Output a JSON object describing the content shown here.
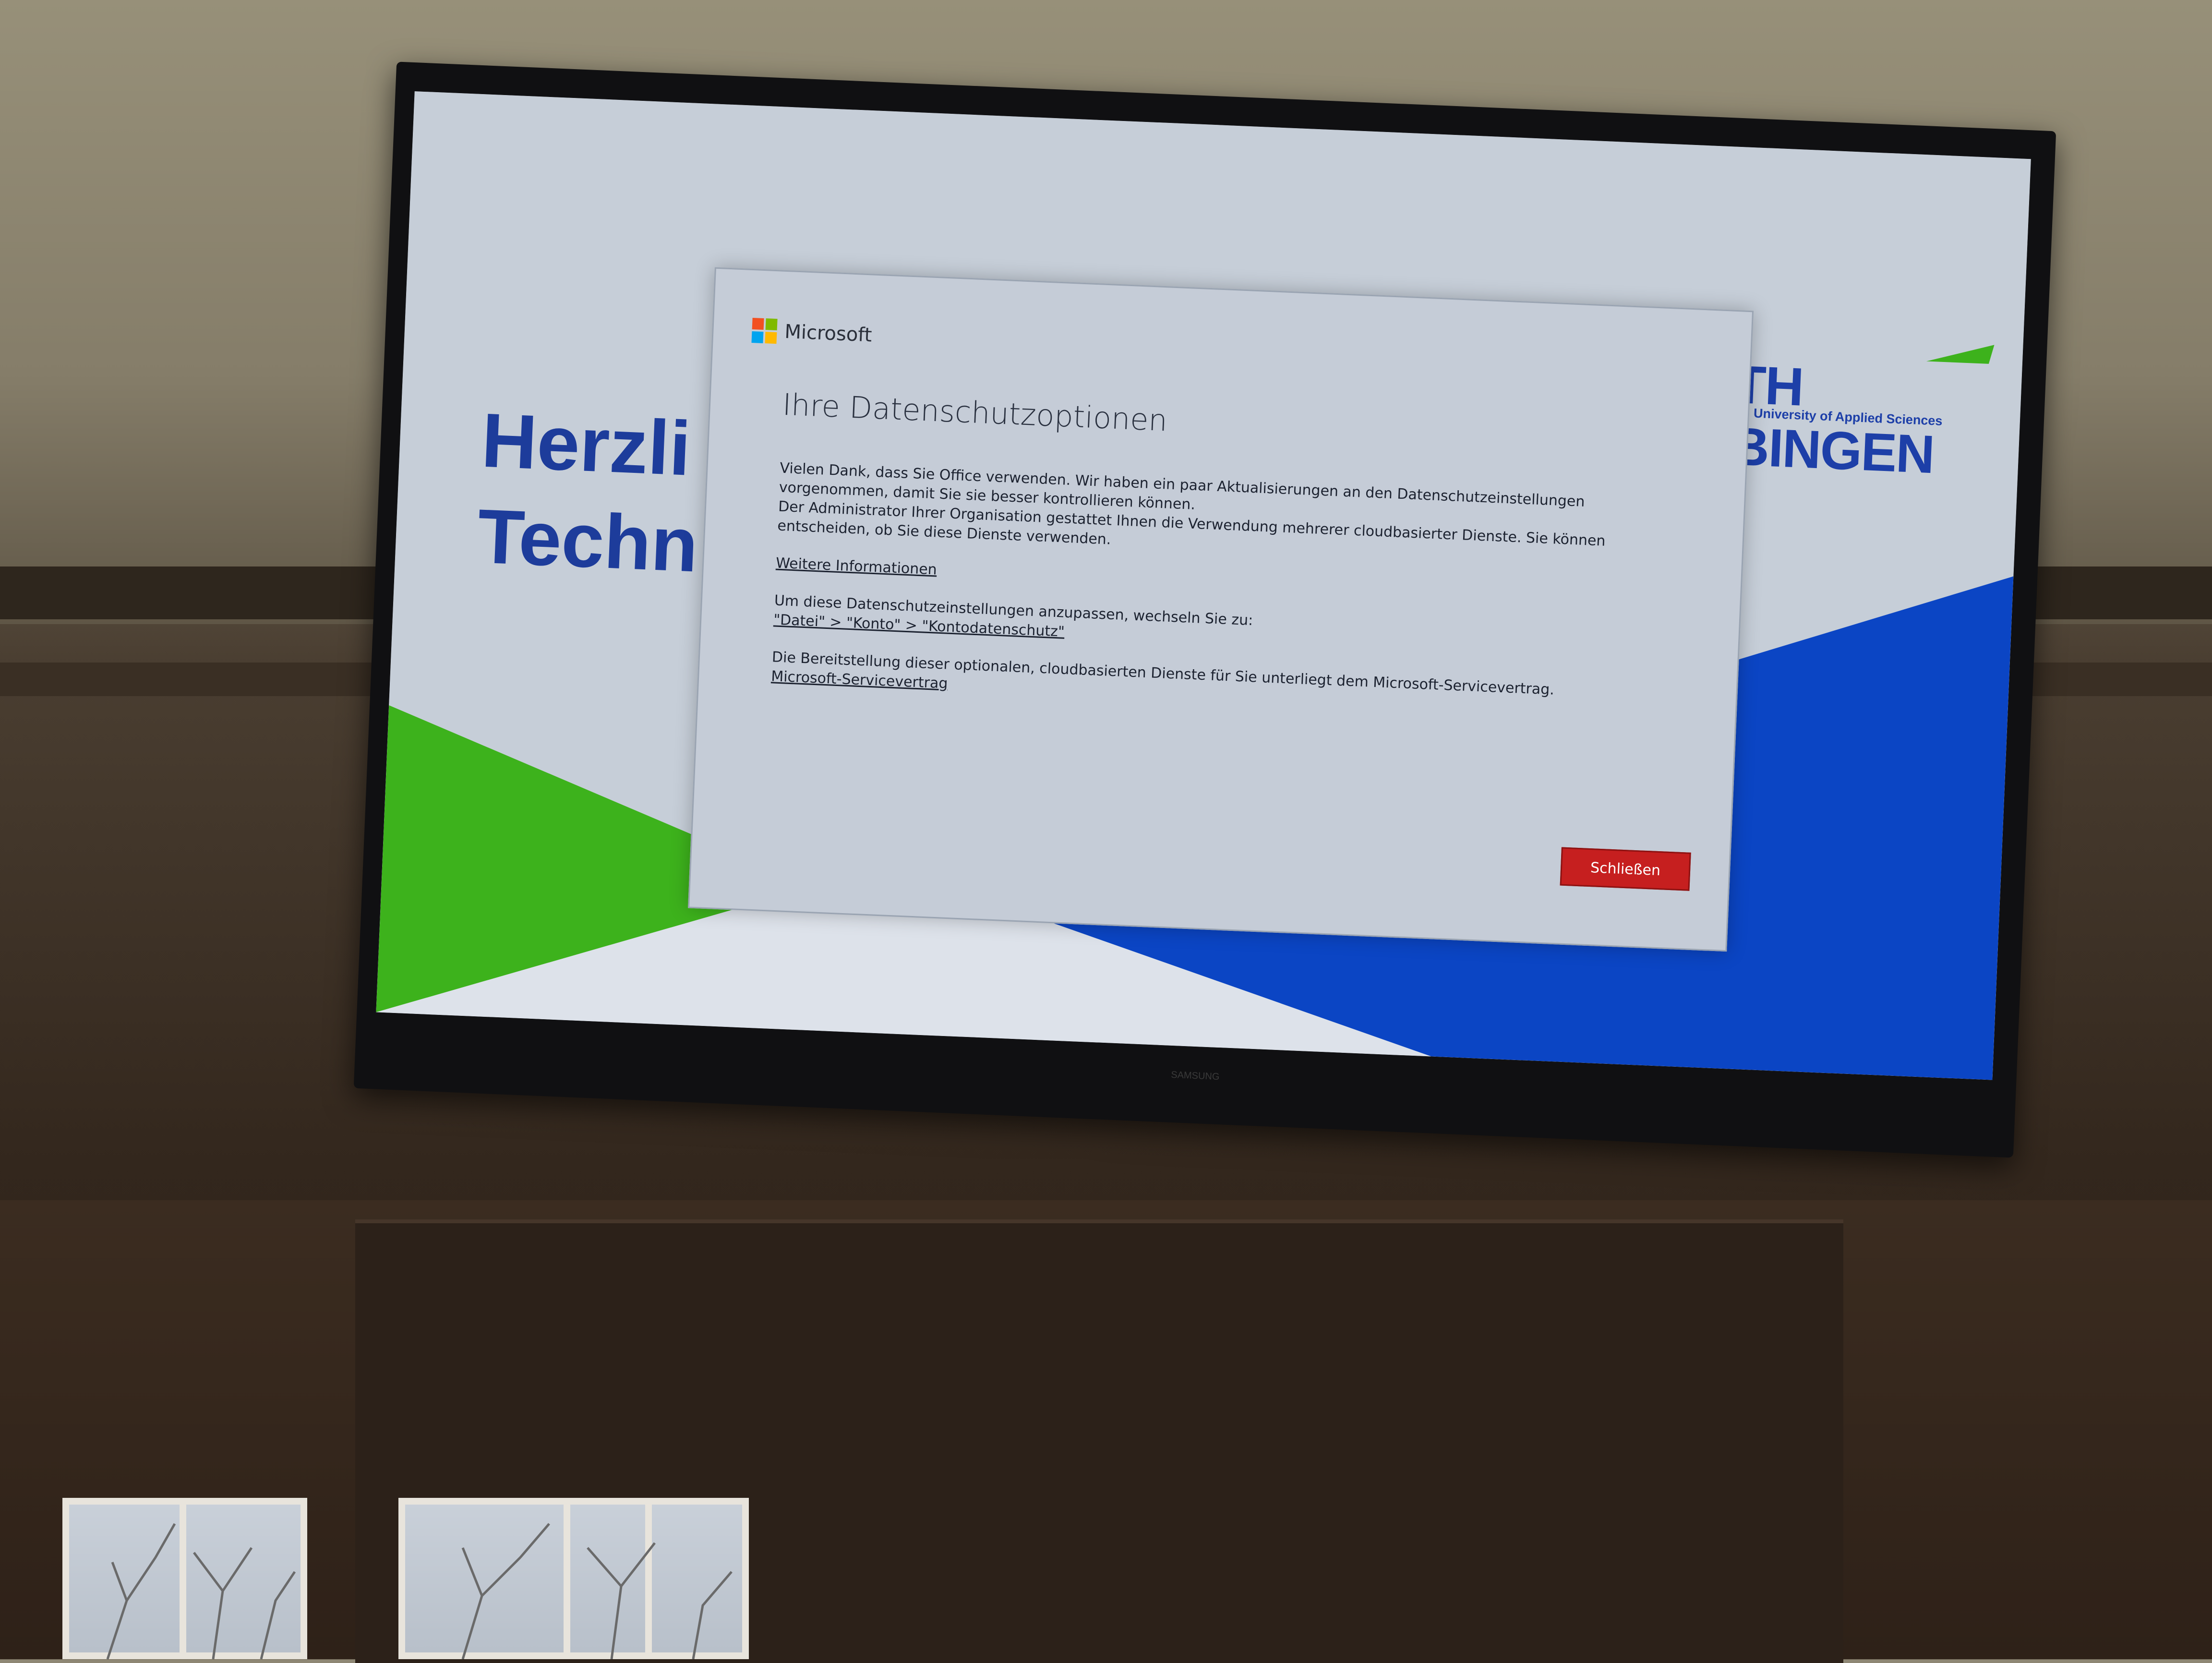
{
  "slide": {
    "welcome_text": "Herzli\nTechn",
    "logo": {
      "name": "TH BINGEN",
      "tagline": "University of Applied Sciences"
    },
    "colors": {
      "green": "#3db21c",
      "blue": "#0b45c4",
      "title_blue": "#1d3c9b"
    }
  },
  "dialog": {
    "brand": "Microsoft",
    "title": "Ihre Datenschutzoptionen",
    "paragraph1_line1": "Vielen Dank, dass Sie Office verwenden. Wir haben ein paar Aktualisierungen an den Datenschutzeinstellungen vorgenommen, damit Sie sie besser kontrollieren können.",
    "paragraph1_line2": "Der Administrator Ihrer Organisation gestattet Ihnen die Verwendung mehrerer cloudbasierter Dienste. Sie können entscheiden, ob Sie diese Dienste verwenden.",
    "more_info_link": "Weitere Informationen",
    "adjust_text": "Um diese Datenschutzeinstellungen anzupassen, wechseln Sie zu:",
    "path_link": "\"Datei\" > \"Konto\" > \"Kontodatenschutz\"",
    "services_text": "Die Bereitstellung dieser optionalen, cloudbasierten Dienste für Sie unterliegt dem Microsoft-Servicevertrag.",
    "service_agreement_link": "Microsoft-Servicevertrag",
    "close_button": "Schließen",
    "accent_color": "#c61f1f"
  },
  "tv": {
    "brand_label": "SAMSUNG"
  }
}
